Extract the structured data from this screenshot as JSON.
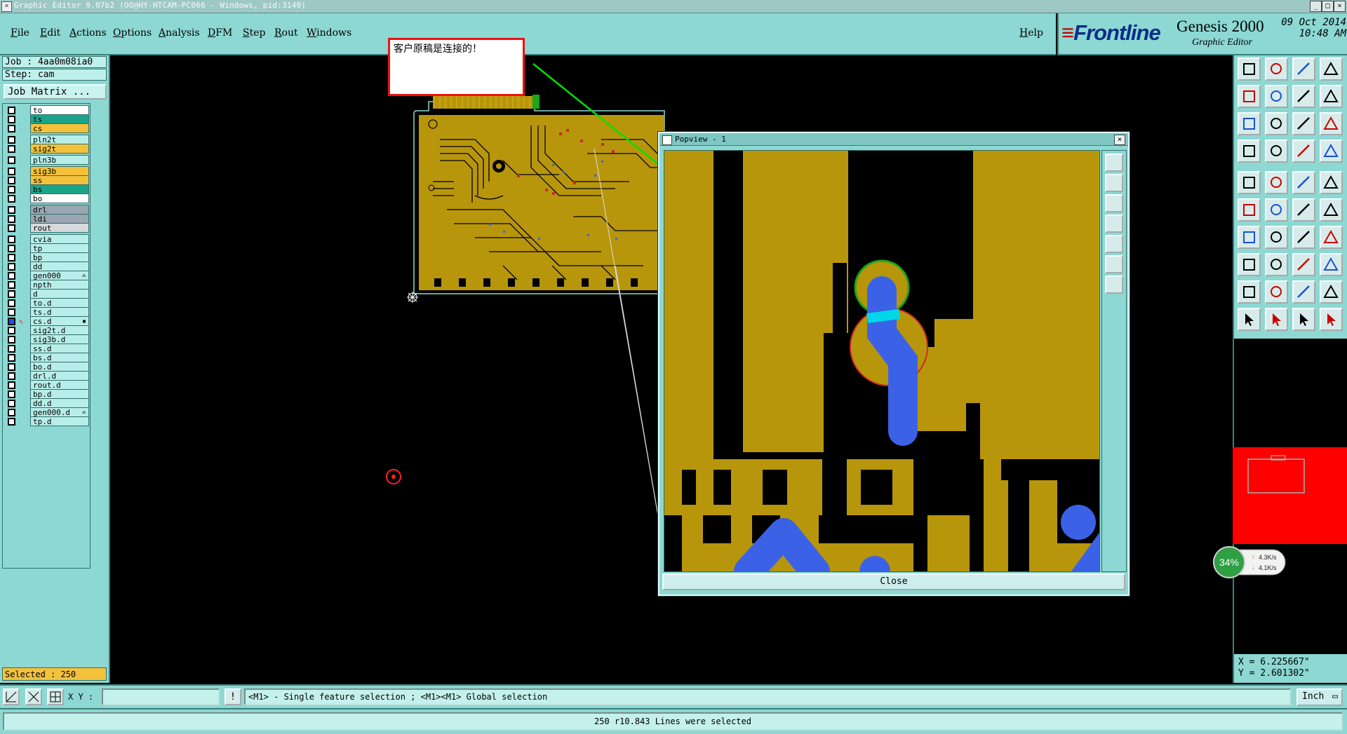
{
  "window": {
    "title": "Graphic Editor 9.07b2 (OO@HY-HTCAM-PC066 - Windows, pid:3140)",
    "controls": [
      "_",
      "□",
      "×"
    ]
  },
  "menu": {
    "items": [
      "File",
      "Edit",
      "Actions",
      "Options",
      "Analysis",
      "DFM",
      "Step",
      "Rout",
      "Windows"
    ],
    "help": "Help"
  },
  "brand": {
    "logo": "Frontline",
    "product": "Genesis 2000",
    "subtitle": "Graphic Editor",
    "date": "09 Oct 2014",
    "time": "10:48 AM"
  },
  "job": {
    "job_line": "Job : 4aa0m08ia0",
    "step_line": "Step: cam",
    "matrix_button": "Job Matrix ..."
  },
  "layers": [
    {
      "name": "to",
      "color": "#ffffff",
      "active": false
    },
    {
      "name": "ts",
      "color": "#1aa58a",
      "active": false
    },
    {
      "name": "cs",
      "color": "#f4c23a",
      "active": false
    },
    {
      "name": "pln2t",
      "color": "#b8eeea",
      "active": false
    },
    {
      "name": "sig2t",
      "color": "#f4c23a",
      "active": false
    },
    {
      "name": "pln3b",
      "color": "#b8eeea",
      "active": false
    },
    {
      "name": "sig3b",
      "color": "#f4c23a",
      "active": false
    },
    {
      "name": "ss",
      "color": "#f4c23a",
      "active": false
    },
    {
      "name": "bs",
      "color": "#1aa58a",
      "active": false
    },
    {
      "name": "bo",
      "color": "#ffffff",
      "active": false
    },
    {
      "name": "drl",
      "color": "#9aa7b0",
      "active": false
    },
    {
      "name": "ldi",
      "color": "#9aa7b0",
      "active": false
    },
    {
      "name": "rout",
      "color": "#d6dadd",
      "active": false
    },
    {
      "name": "cvia",
      "color": "#b8eeea",
      "active": false
    },
    {
      "name": "tp",
      "color": "#b8eeea",
      "active": false
    },
    {
      "name": "bp",
      "color": "#b8eeea",
      "active": false
    },
    {
      "name": "dd",
      "color": "#b8eeea",
      "active": false
    },
    {
      "name": "gen000",
      "color": "#b8eeea",
      "active": false,
      "mark": "✍"
    },
    {
      "name": "npth",
      "color": "#b8eeea",
      "active": false
    },
    {
      "name": "d",
      "color": "#b8eeea",
      "active": false
    },
    {
      "name": "to.d",
      "color": "#b8eeea",
      "active": false
    },
    {
      "name": "ts.d",
      "color": "#b8eeea",
      "active": false
    },
    {
      "name": "cs.d",
      "color": "#b8eeea",
      "active": true,
      "mark": "▪"
    },
    {
      "name": "sig2t.d",
      "color": "#b8eeea",
      "active": false
    },
    {
      "name": "sig3b.d",
      "color": "#b8eeea",
      "active": false
    },
    {
      "name": "ss.d",
      "color": "#b8eeea",
      "active": false
    },
    {
      "name": "bs.d",
      "color": "#b8eeea",
      "active": false
    },
    {
      "name": "bo.d",
      "color": "#b8eeea",
      "active": false
    },
    {
      "name": "drl.d",
      "color": "#b8eeea",
      "active": false
    },
    {
      "name": "rout.d",
      "color": "#b8eeea",
      "active": false
    },
    {
      "name": "bp.d",
      "color": "#b8eeea",
      "active": false
    },
    {
      "name": "dd.d",
      "color": "#b8eeea",
      "active": false
    },
    {
      "name": "gen000.d",
      "color": "#b8eeea",
      "active": false,
      "mark": "✍"
    },
    {
      "name": "tp.d",
      "color": "#b8eeea",
      "active": false
    }
  ],
  "selected": "Selected : 250",
  "callout": "客户原稿是连接的！",
  "popview": {
    "title": "Popview - 1",
    "close": "Close"
  },
  "network": {
    "percent": "34%",
    "up": "4.3K/s",
    "down": "4.1K/s"
  },
  "coords": {
    "x": "X = 6.225667\"",
    "y": "Y = 2.601302\""
  },
  "cmd": {
    "xy_label": "X Y :",
    "xy_value": "",
    "hint": "<M1> - Single feature selection ; <M1><M1> Global selection",
    "unit": "Inch"
  },
  "status": "250 r10.843 Lines were selected",
  "colors": {
    "panel": "#8dd8d3",
    "copper": "#b8960b",
    "selection": "#3b62e6",
    "highlight": "#00d7e8",
    "arrow": "#00e000"
  },
  "toolbar_icons": [
    "open-step-icon",
    "save-icon",
    "home-icon",
    "layout-icon",
    "zoom-left-icon",
    "zoom-right-icon",
    "window-icon",
    "redraw-icon",
    "fit-icon",
    "zoom-home-icon",
    "scale-icon",
    "help-icon",
    "graphic-control-icon",
    "grid-icon",
    "filter-icon",
    "snap-icon",
    "pad-add-icon",
    "shape-add-icon",
    "line-add-icon",
    "target-icon",
    "net-icon",
    "cross-icon",
    "connect-icon",
    "link-icon",
    "line-draw-icon",
    "line-slope-icon",
    "arc-icon",
    "text-icon",
    "move-icon",
    "dash-icon",
    "measure-icon",
    "copy-icon",
    "triangle-icon",
    "slope-icon",
    "profile-icon",
    "outline-icon",
    "pointer-icon",
    "select-icon",
    "drag-icon",
    "stretch-icon"
  ]
}
